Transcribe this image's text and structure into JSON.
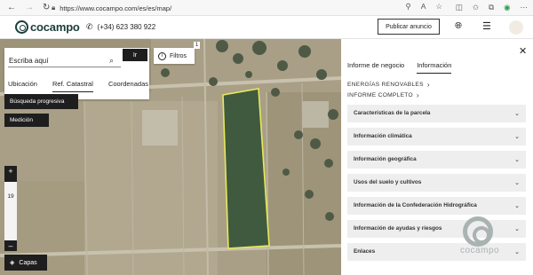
{
  "browser": {
    "url": "https://www.cocampo.com/es/es/map/",
    "nav_icons": [
      "back-icon",
      "forward-icon",
      "reload-icon"
    ],
    "address_icons": [
      "zoom-icon",
      "read-aloud-icon",
      "favorite-icon"
    ],
    "toolbar_icons": [
      "split-screen-icon",
      "favorites-icon",
      "collections-icon",
      "extension-icon",
      "more-icon"
    ]
  },
  "header": {
    "logo_text": "cocampo",
    "phone": "(+34) 623 380 922",
    "publish_button": "Publicar anuncio",
    "brand_color": "#1a3d3a"
  },
  "search": {
    "placeholder": "Escriba aquí",
    "go_button": "Ir",
    "tabs": [
      "Ubicación",
      "Ref. Catastral",
      "Coordenadas"
    ],
    "active_tab": "Ref. Catastral"
  },
  "map": {
    "filters_label": "Filtros",
    "filters_count": "1",
    "progressive_search": "Búsqueda progresiva",
    "measurement": "Medición",
    "zoom_in": "+",
    "zoom_out": "–",
    "zoom_level": "19",
    "layers": "Capas",
    "highlight_color": "#e8e85a"
  },
  "panel": {
    "tabs": [
      "Informe de negocio",
      "Información"
    ],
    "active_tab": "Información",
    "links": [
      "ENERGÍAS RENOVABLES",
      "INFORME COMPLETO"
    ],
    "sections": [
      "Características de la parcela",
      "Información climática",
      "Información geográfica",
      "Usos del suelo y cultivos",
      "Información de la Confederación Hidrográfica",
      "Información de ayudas y riesgos",
      "Enlaces"
    ],
    "watermark_text": "cocampo"
  }
}
